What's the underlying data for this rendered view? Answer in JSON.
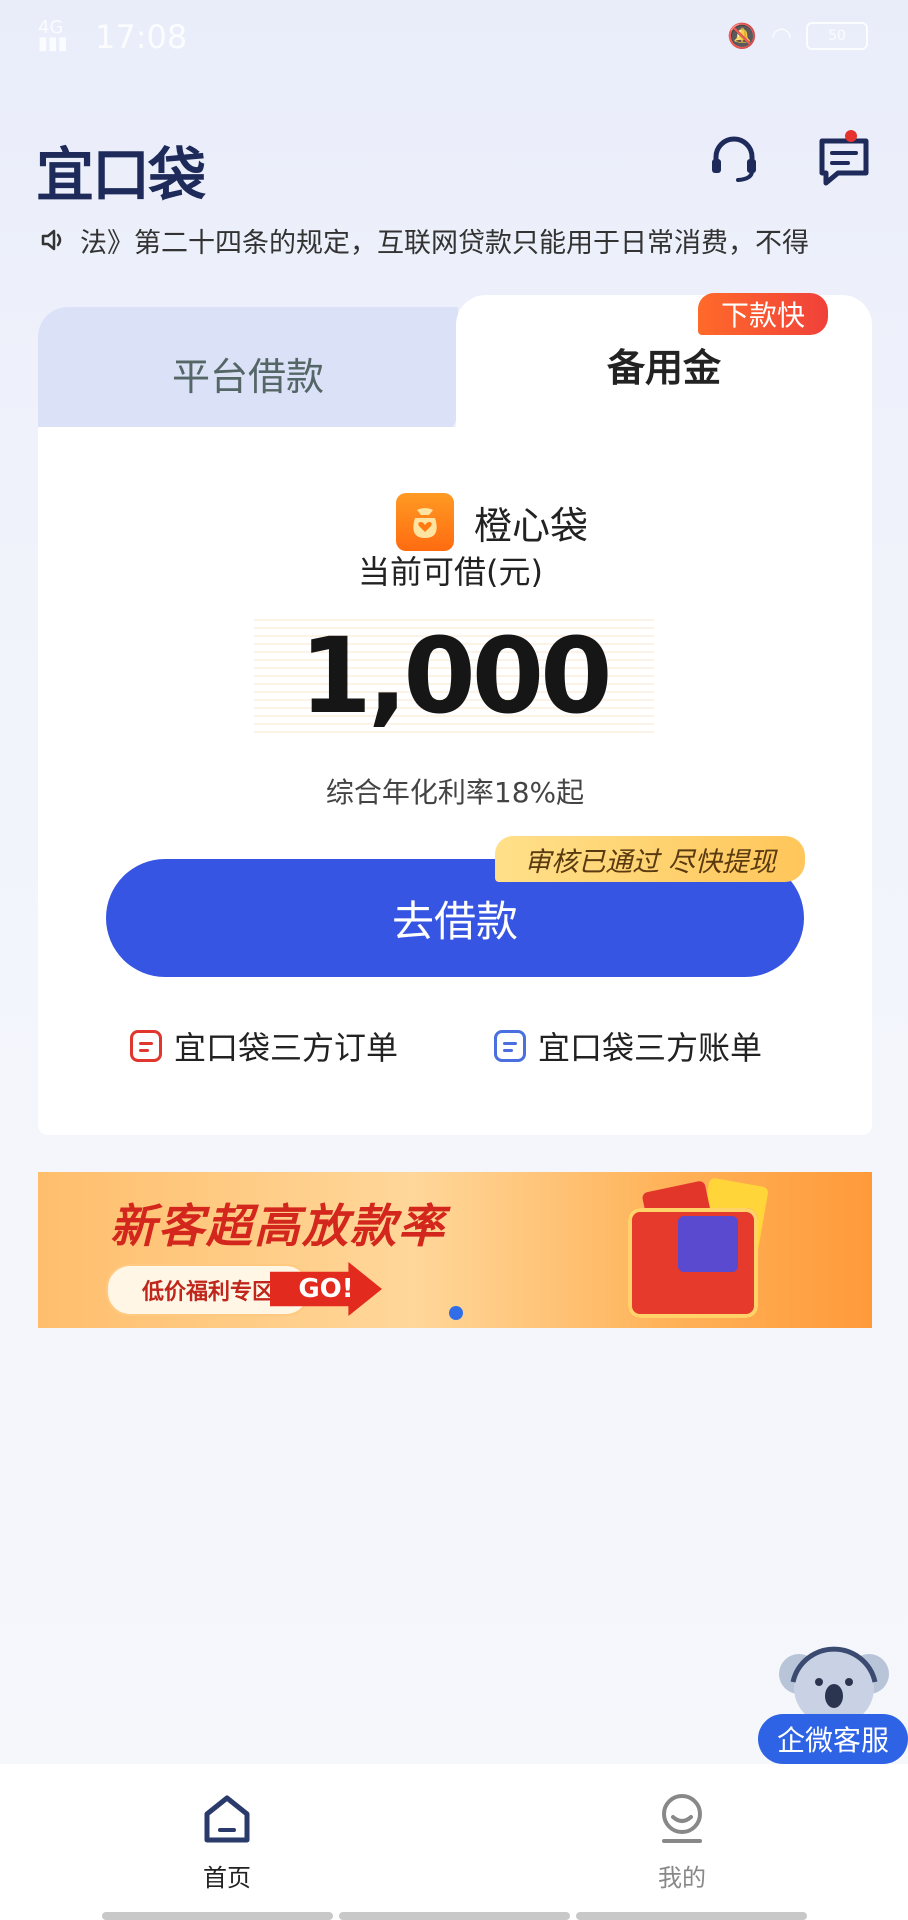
{
  "status_bar": {
    "time": "17:08",
    "signal": "4G",
    "battery": "50"
  },
  "header": {
    "logo": "宜口袋"
  },
  "notice": {
    "text": "法》第二十四条的规定，互联网贷款只能用于日常消费，不得"
  },
  "tabs": {
    "platform": "平台借款",
    "reserve": "备用金",
    "reserve_badge": "下款快"
  },
  "product": {
    "name": "橙心袋",
    "available_label": "当前可借(元)",
    "amount": "1,000",
    "rate_text": "综合年化利率18%起"
  },
  "actions": {
    "borrow": "去借款",
    "approved_tag": "审核已通过 尽快提现"
  },
  "links": {
    "orders": "宜口袋三方订单",
    "bills": "宜口袋三方账单"
  },
  "banner": {
    "title": "新客超高放款率",
    "subtitle": "低价福利专区",
    "go": "GO!"
  },
  "float_service": {
    "label": "企微客服"
  },
  "bottom_nav": {
    "home": "首页",
    "mine": "我的"
  },
  "colors": {
    "primary": "#3655e3",
    "accent": "#f0413a",
    "badge": "#ffc65a"
  }
}
